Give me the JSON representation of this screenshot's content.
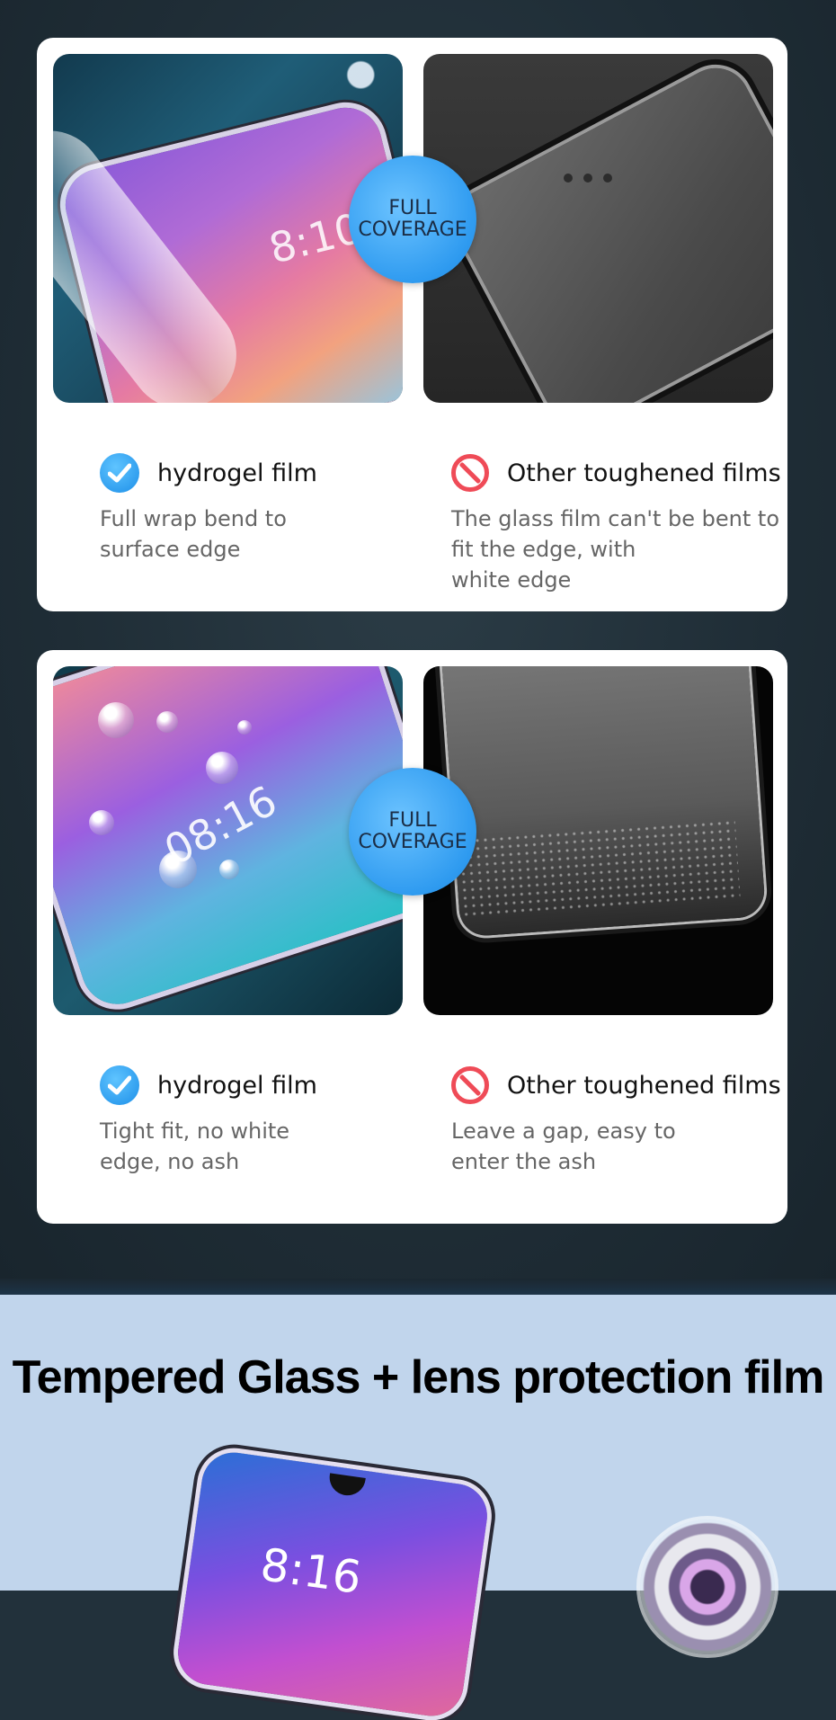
{
  "badge": {
    "line1": "FULL",
    "line2": "COVERAGE"
  },
  "card1": {
    "left_clock": "8:10",
    "left": {
      "title": "hydrogel film",
      "desc": "Full wrap bend to\nsurface edge"
    },
    "right": {
      "title": "Other toughened films",
      "desc": "The glass film can't be bent to\nfit the edge, with\nwhite edge"
    }
  },
  "card2": {
    "left_clock": "08:16",
    "left": {
      "title": "hydrogel film",
      "desc": "Tight fit, no white\nedge, no ash"
    },
    "right": {
      "title": "Other toughened films",
      "desc": "Leave a gap, easy to\nenter the ash"
    }
  },
  "bottom": {
    "headline": "Tempered Glass + lens protection film",
    "clock": "8:16"
  },
  "colors": {
    "accent_blue": "#2f9bf0",
    "no_red": "#ef4b57",
    "light_bg": "#c1d5ec"
  },
  "icons": {
    "check": "check-circle-icon",
    "no": "prohibited-icon"
  }
}
